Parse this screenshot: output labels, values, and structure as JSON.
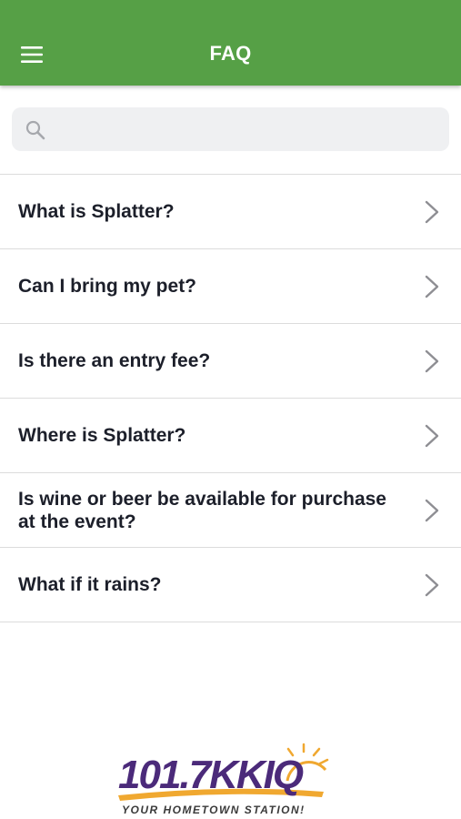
{
  "header": {
    "title": "FAQ",
    "menu_icon": "hamburger-menu-icon",
    "background_color": "#56a046"
  },
  "search": {
    "placeholder": "",
    "value": "",
    "icon": "search-icon"
  },
  "faq": {
    "items": [
      {
        "question": "What is Splatter?",
        "icon": "chevron-right-icon"
      },
      {
        "question": "Can I bring my pet?",
        "icon": "chevron-right-icon"
      },
      {
        "question": "Is there an entry fee?",
        "icon": "chevron-right-icon"
      },
      {
        "question": "Where is Splatter?",
        "icon": "chevron-right-icon"
      },
      {
        "question": "Is wine or beer be available for purchase at the event?",
        "icon": "chevron-right-icon"
      },
      {
        "question": "What if it rains?",
        "icon": "chevron-right-icon"
      }
    ]
  },
  "footer": {
    "logo_main": "101.7KKIQ",
    "logo_tagline": "YOUR HOMETOWN STATION!",
    "logo_colors": {
      "number": "#2b2b2b",
      "call_letters": "#4b2a7a",
      "sun": "#f0a830"
    }
  }
}
